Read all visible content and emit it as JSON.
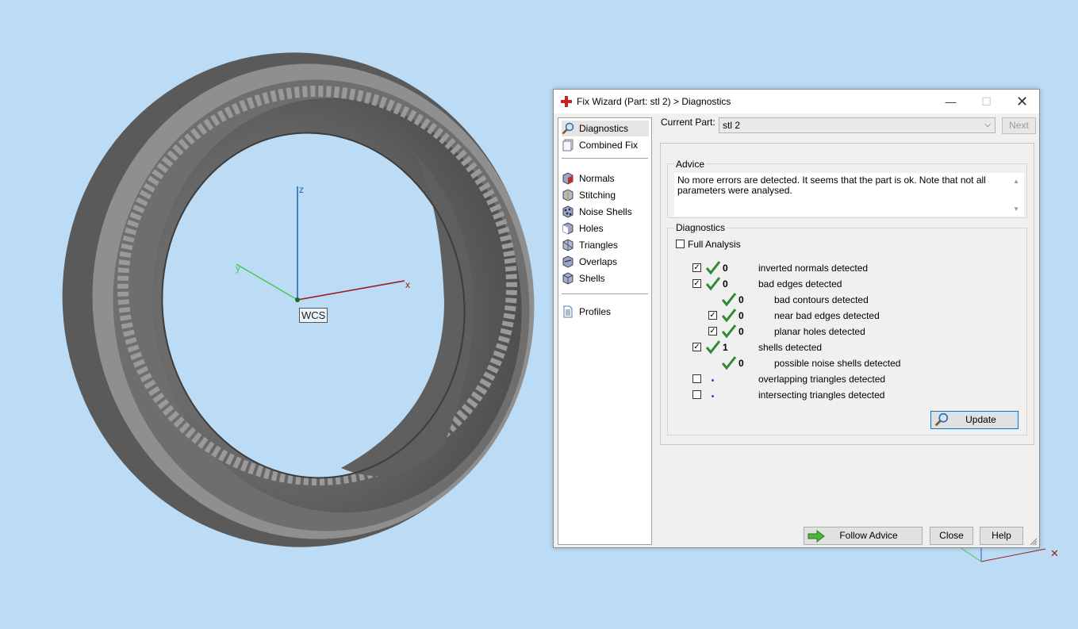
{
  "viewport": {
    "wcs_label": "WCS",
    "axes": {
      "x": "x",
      "y": "y",
      "z": "z"
    }
  },
  "dialog": {
    "title": "Fix Wizard (Part: stl 2) > Diagnostics",
    "nav": {
      "items": [
        {
          "label": "Diagnostics",
          "icon": "magnifier-icon",
          "selected": true
        },
        {
          "label": "Combined Fix",
          "icon": "combined-fix-icon"
        },
        {
          "label": "Normals",
          "icon": "normals-icon"
        },
        {
          "label": "Stitching",
          "icon": "stitching-icon"
        },
        {
          "label": "Noise Shells",
          "icon": "noise-shells-icon"
        },
        {
          "label": "Holes",
          "icon": "holes-icon"
        },
        {
          "label": "Triangles",
          "icon": "triangles-icon"
        },
        {
          "label": "Overlaps",
          "icon": "overlaps-icon"
        },
        {
          "label": "Shells",
          "icon": "shells-icon"
        },
        {
          "label": "Profiles",
          "icon": "profiles-icon"
        }
      ]
    },
    "current_part": {
      "label": "Current Part:",
      "value": "stl 2"
    },
    "next_label": "Next",
    "advice": {
      "title": "Advice",
      "text": "No more errors are detected. It seems that the part is ok. Note that not all parameters were analysed."
    },
    "diagnostics": {
      "title": "Diagnostics",
      "full_analysis_label": "Full Analysis",
      "full_analysis_checked": false,
      "rows": [
        {
          "checked": true,
          "status": "check",
          "count": "0",
          "label": "inverted normals detected"
        },
        {
          "checked": true,
          "status": "check",
          "count": "0",
          "label": "bad edges detected"
        },
        {
          "checked": null,
          "status": "check",
          "count": "0",
          "label": "bad contours detected"
        },
        {
          "checked": true,
          "status": "check",
          "count": "0",
          "label": "near bad edges detected"
        },
        {
          "checked": true,
          "status": "check",
          "count": "0",
          "label": "planar holes detected"
        },
        {
          "checked": true,
          "status": "check",
          "count": "1",
          "label": "shells detected"
        },
        {
          "checked": null,
          "status": "check",
          "count": "0",
          "label": "possible noise shells detected"
        },
        {
          "checked": false,
          "status": "dot",
          "count": "",
          "label": "overlapping triangles detected"
        },
        {
          "checked": false,
          "status": "dot",
          "count": "",
          "label": "intersecting triangles detected"
        }
      ]
    },
    "buttons": {
      "update": "Update",
      "follow_advice": "Follow Advice",
      "close": "Close",
      "help": "Help"
    }
  }
}
